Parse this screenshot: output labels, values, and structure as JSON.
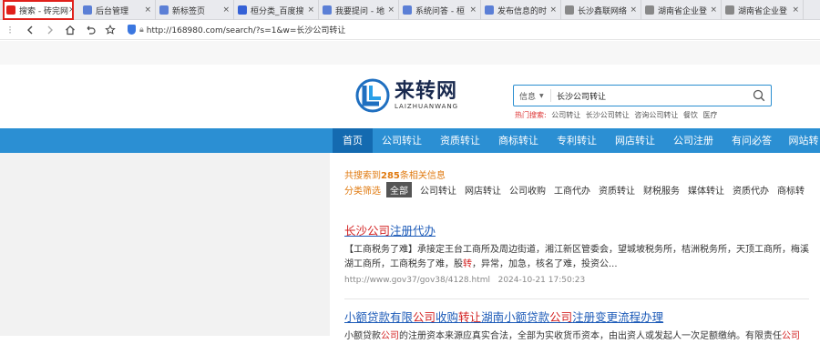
{
  "browser": {
    "tabs": [
      {
        "title": "搜索 - 砖完网",
        "fav_color": "#e0201b",
        "fav_icon": "page-icon",
        "active": true
      },
      {
        "title": "后台管理",
        "fav_color": "#5b7fd6",
        "fav_icon": "page-icon"
      },
      {
        "title": "新标签页",
        "fav_color": "#5b7fd6",
        "fav_icon": "newtab-icon"
      },
      {
        "title": "桓分类_百度搜",
        "fav_color": "#3561d6",
        "fav_icon": "baidu-icon"
      },
      {
        "title": "我要提问 - 地",
        "fav_color": "#5b7fd6",
        "fav_icon": "page-icon"
      },
      {
        "title": "系统问答 - 桓",
        "fav_color": "#5b7fd6",
        "fav_icon": "page-icon"
      },
      {
        "title": "发布信息的时",
        "fav_color": "#5b7fd6",
        "fav_icon": "page-icon"
      },
      {
        "title": "长沙鑫联网络",
        "fav_color": "#888888",
        "fav_icon": "globe-icon"
      },
      {
        "title": "湖南省企业登",
        "fav_color": "#888888",
        "fav_icon": "globe-icon"
      },
      {
        "title": "湖南省企业登",
        "fav_color": "#888888",
        "fav_icon": "globe-icon"
      }
    ],
    "url": "http://168980.com/search/?s=1&w=长沙公司转让"
  },
  "logo": {
    "cn": "来转网",
    "en": "LAIZHUANWANG"
  },
  "search": {
    "category": "信息",
    "value": "长沙公司转让",
    "hot_label": "热门搜索:",
    "hot_items": [
      "公司转让",
      "长沙公司转让",
      "咨询公司转让",
      "餐饮",
      "医疗"
    ]
  },
  "nav": {
    "items": [
      "首页",
      "公司转让",
      "资质转让",
      "商标转让",
      "专利转让",
      "网店转让",
      "公司注册",
      "有问必答",
      "网站转"
    ]
  },
  "results_summary": {
    "prefix": "共搜索到",
    "count": "285",
    "suffix": "条相关信息"
  },
  "filter": {
    "label": "分类筛选",
    "options": [
      "全部",
      "公司转让",
      "网店转让",
      "公司收购",
      "工商代办",
      "资质转让",
      "财税服务",
      "媒体转让",
      "资质代办",
      "商标转"
    ]
  },
  "results": [
    {
      "title_parts": [
        {
          "text": "长沙公司",
          "hl": true
        },
        {
          "text": "注册代办",
          "hl": false
        }
      ],
      "desc_parts": [
        {
          "text": "【工商税务了难】承接定王台工商所及周边街道，湘江新区管委会，望城坡税务所，桔洲税务所，天顶工商所，梅溪湖工商所，工商税务了难，股",
          "hl": false
        },
        {
          "text": "转",
          "hl": true
        },
        {
          "text": "，异常，加急，核名了难，投资公...",
          "hl": false
        }
      ],
      "url": "http://www.gov37/gov38/4128.html",
      "time": "2024-10-21 17:50:23"
    },
    {
      "title_parts": [
        {
          "text": "小额贷款有限",
          "hl": false
        },
        {
          "text": "公司",
          "hl": true
        },
        {
          "text": "收购",
          "hl": false
        },
        {
          "text": "转让",
          "hl": true
        },
        {
          "text": "湖南小额贷款",
          "hl": false
        },
        {
          "text": "公司",
          "hl": true
        },
        {
          "text": "注册变更流程办理",
          "hl": false
        }
      ],
      "desc_parts": [
        {
          "text": "小额贷款",
          "hl": false
        },
        {
          "text": "公司",
          "hl": true
        },
        {
          "text": "的注册资本来源应真实合法，全部为实收货币资本，由出资人或发起人一次足额缴纳。有限责任",
          "hl": false
        },
        {
          "text": "公司",
          "hl": true
        }
      ],
      "url": "",
      "time": ""
    }
  ]
}
